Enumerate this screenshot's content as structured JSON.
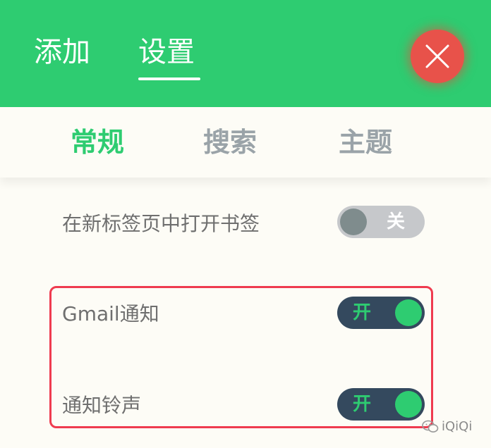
{
  "header": {
    "tabs": [
      {
        "label": "添加"
      },
      {
        "label": "设置"
      }
    ],
    "active_tab": "设置",
    "close_icon": "close-icon"
  },
  "subtabs": [
    {
      "label": "常规"
    },
    {
      "label": "搜索"
    },
    {
      "label": "主题"
    }
  ],
  "active_subtab": "常规",
  "settings": [
    {
      "label": "在新标签页中打开书签",
      "toggle_text": "关",
      "enabled": false
    },
    {
      "label": "Gmail通知",
      "toggle_text": "开",
      "enabled": true
    },
    {
      "label": "通知铃声",
      "toggle_text": "开",
      "enabled": true
    }
  ],
  "watermark": {
    "text": "iQiQi",
    "icon": "wechat-icon"
  },
  "colors": {
    "primary_green": "#2ecc71",
    "close_red": "#e8524a",
    "toggle_on_bg": "#34495e",
    "toggle_off_bg": "#c6c8cb",
    "highlight_border": "#ef3b4f",
    "background": "#fdfcf6"
  }
}
